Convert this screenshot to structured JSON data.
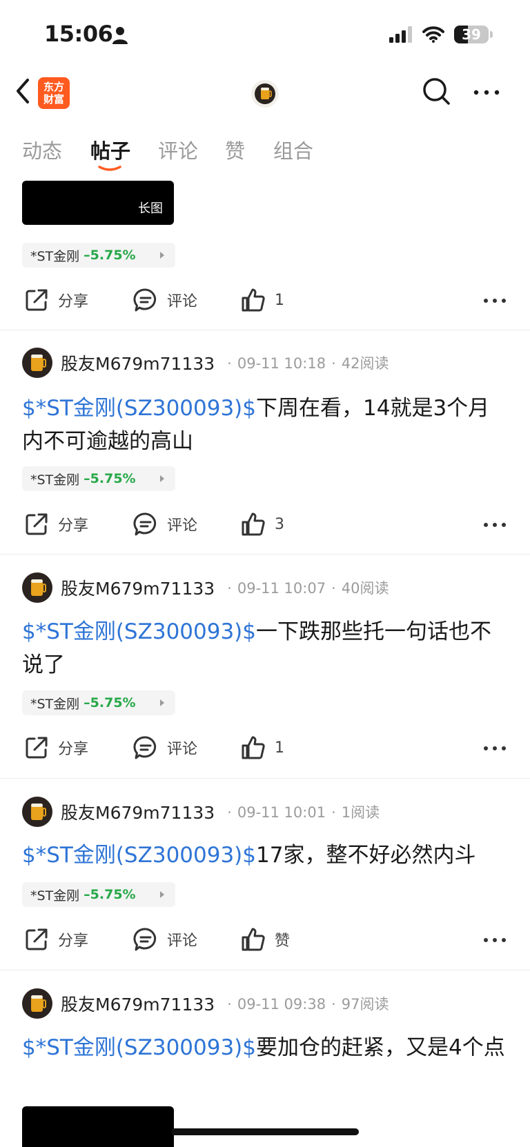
{
  "status": {
    "time": "15:06",
    "battery": "39",
    "battery_level": 0.39
  },
  "nav": {
    "logo_line1": "东方",
    "logo_line2": "财富"
  },
  "tabs": [
    {
      "label": "动态"
    },
    {
      "label": "帖子"
    },
    {
      "label": "评论"
    },
    {
      "label": "赞"
    },
    {
      "label": "组合"
    }
  ],
  "active_tab": "帖子",
  "top_fragment": {
    "long_image_label": "长图",
    "stock": {
      "name": "*ST金刚",
      "change": "–5.75%"
    },
    "share": "分享",
    "comment": "评论",
    "likes": "1"
  },
  "posts": [
    {
      "user": "股友M679m71133",
      "date": "09-11 10:18",
      "reads": "42阅读",
      "link": "$*ST金刚(SZ300093)$",
      "text": "下周在看，14就是3个月内不可逾越的高山",
      "stock": {
        "name": "*ST金刚",
        "change": "–5.75%"
      },
      "share": "分享",
      "comment": "评论",
      "likes": "3"
    },
    {
      "user": "股友M679m71133",
      "date": "09-11 10:07",
      "reads": "40阅读",
      "link": "$*ST金刚(SZ300093)$",
      "text": "一下跌那些托一句话也不说了",
      "stock": {
        "name": "*ST金刚",
        "change": "–5.75%"
      },
      "share": "分享",
      "comment": "评论",
      "likes": "1"
    },
    {
      "user": "股友M679m71133",
      "date": "09-11 10:01",
      "reads": "1阅读",
      "link": "$*ST金刚(SZ300093)$",
      "text": "17家，整不好必然内斗",
      "stock": {
        "name": "*ST金刚",
        "change": "–5.75%"
      },
      "share": "分享",
      "comment": "评论",
      "likes": "赞"
    },
    {
      "user": "股友M679m71133",
      "date": "09-11 09:38",
      "reads": "97阅读",
      "link": "$*ST金刚(SZ300093)$",
      "text": "要加仓的赶紧，又是4个点"
    }
  ],
  "colors": {
    "link": "#2e74d6",
    "down": "#27a849",
    "brand": "#ff5a1f",
    "tab_underline": "#ff5a1f"
  }
}
